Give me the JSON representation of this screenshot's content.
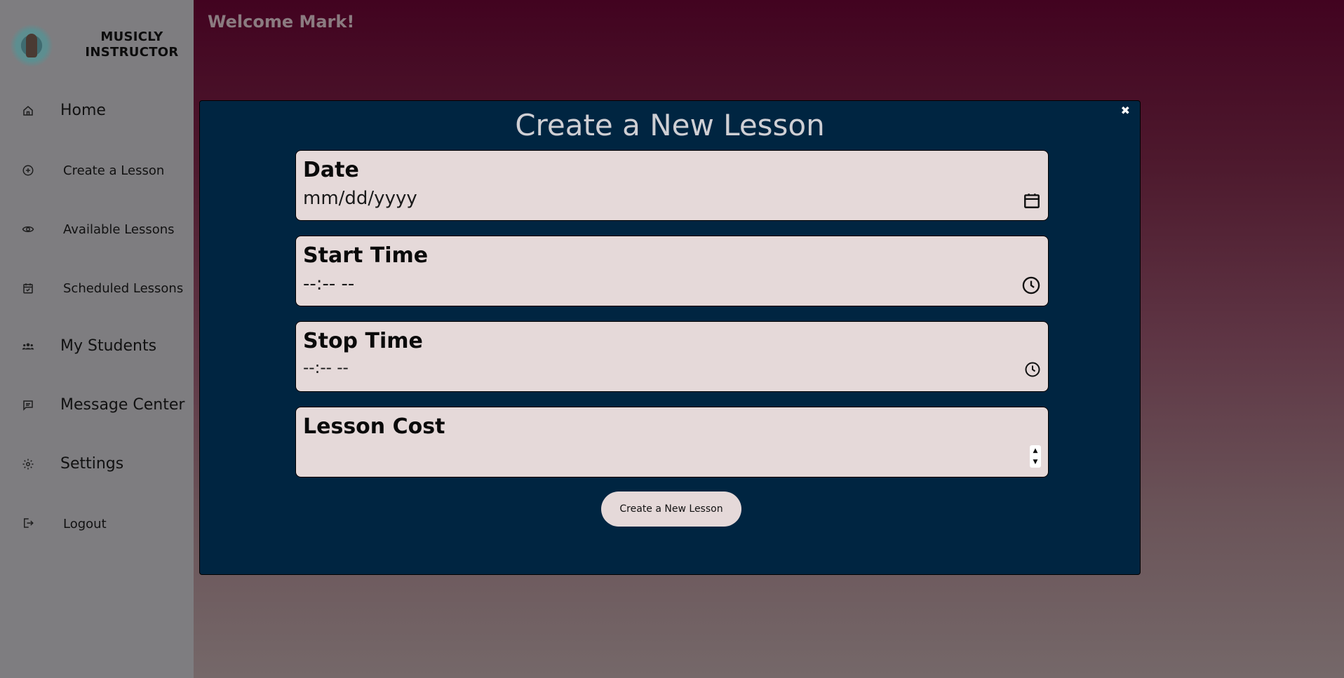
{
  "brand": {
    "name_line1": "MUSICLY",
    "name_line2": "INSTRUCTOR",
    "logo_icon": "logo-icon"
  },
  "sidebar": {
    "items": [
      {
        "label": "Home",
        "icon": "home-icon"
      },
      {
        "label": "Create a Lesson",
        "icon": "plus-circle-icon"
      },
      {
        "label": "Available Lessons",
        "icon": "eye-icon"
      },
      {
        "label": "Scheduled Lessons",
        "icon": "calendar-check-icon"
      },
      {
        "label": "My Students",
        "icon": "users-icon"
      },
      {
        "label": "Message Center",
        "icon": "message-icon"
      },
      {
        "label": "Settings",
        "icon": "gear-icon"
      },
      {
        "label": "Logout",
        "icon": "logout-icon"
      }
    ]
  },
  "header": {
    "welcome": "Welcome Mark!"
  },
  "modal": {
    "title": "Create a New Lesson",
    "close_symbol": "✖",
    "fields": {
      "date": {
        "label": "Date",
        "placeholder": "mm/dd/yyyy",
        "icon": "calendar-icon"
      },
      "start_time": {
        "label": "Start Time",
        "placeholder": "--:-- --",
        "icon": "clock-icon"
      },
      "stop_time": {
        "label": "Stop Time",
        "placeholder": "--:-- --",
        "icon": "clock-icon"
      },
      "lesson_cost": {
        "label": "Lesson Cost",
        "value": "",
        "spinner_up": "▲",
        "spinner_down": "▼"
      }
    },
    "submit_label": "Create a New Lesson"
  },
  "colors": {
    "background_top": "#420320",
    "background_bottom": "#756869",
    "sidebar": "#7e7d80",
    "modal": "#002541",
    "field": "#e5d9d9",
    "welcome_text": "#8b7b80",
    "title_text": "#cfcfd4"
  }
}
